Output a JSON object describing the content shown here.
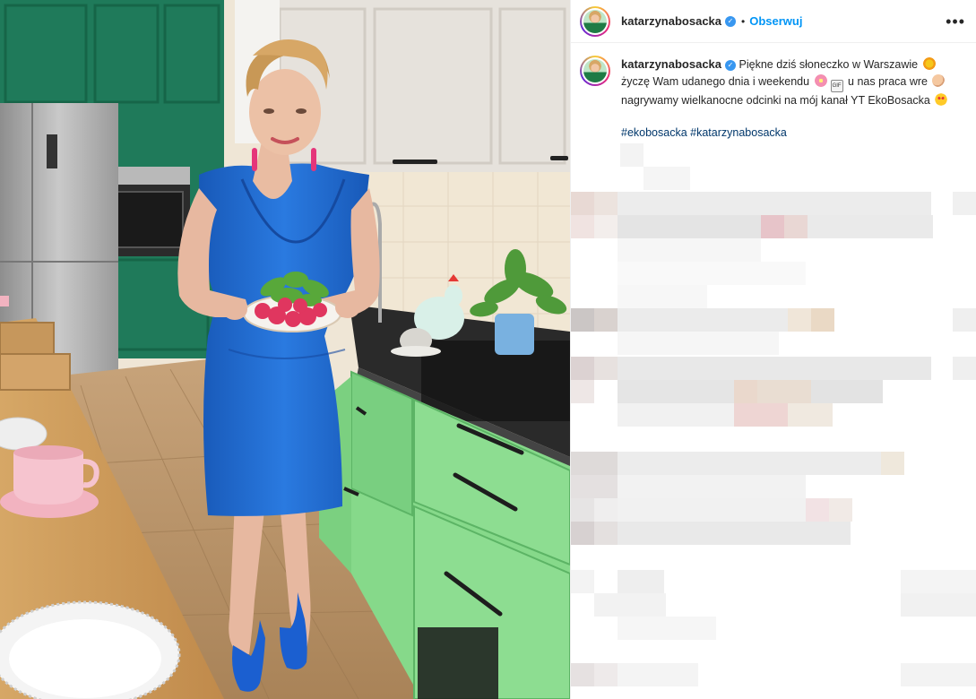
{
  "post": {
    "username": "katarzynabosacka",
    "verified_mark": "✓",
    "separator": "•",
    "follow_label": "Obserwuj",
    "more_label": "•••"
  },
  "caption": {
    "username": "katarzynabosacka",
    "text_1": "Piękne dziś słoneczko w Warszawie",
    "text_2": "życzę Wam udanego dnia i weekendu",
    "text_3": "u nas praca wre",
    "text_4": "nagrywamy wielkanocne odcinki na mój kanał YT EkoBosacka",
    "gif_badge": "GIF",
    "hashtags": [
      "#ekobosacka",
      "#katarzynabosacka"
    ]
  },
  "emoji": {
    "sun": "sun-emoji",
    "flower": "flower-emoji",
    "gif": "gif-emoji",
    "arm": "flexed-arm-emoji",
    "hearteyes": "heart-eyes-emoji"
  },
  "colors": {
    "link": "#0095f6",
    "hashtag": "#00376b",
    "dress": "#1f6fd1",
    "cabinet_green": "#86d98a",
    "dark_green": "#1f7a5a"
  }
}
